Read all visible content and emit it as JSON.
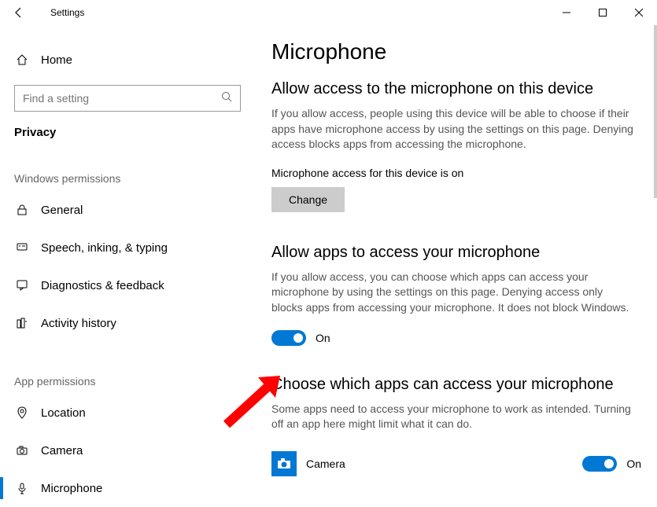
{
  "window": {
    "title": "Settings"
  },
  "sidebar": {
    "home": "Home",
    "search_placeholder": "Find a setting",
    "breadcrumb": "Privacy",
    "section1_header": "Windows permissions",
    "section2_header": "App permissions",
    "items1": [
      {
        "label": "General"
      },
      {
        "label": "Speech, inking, & typing"
      },
      {
        "label": "Diagnostics & feedback"
      },
      {
        "label": "Activity history"
      }
    ],
    "items2": [
      {
        "label": "Location"
      },
      {
        "label": "Camera"
      },
      {
        "label": "Microphone"
      }
    ]
  },
  "content": {
    "page_title": "Microphone",
    "sec1_title": "Allow access to the microphone on this device",
    "sec1_desc": "If you allow access, people using this device will be able to choose if their apps have microphone access by using the settings on this page. Denying access blocks apps from accessing the microphone.",
    "sec1_status": "Microphone access for this device is on",
    "change_btn": "Change",
    "sec2_title": "Allow apps to access your microphone",
    "sec2_desc": "If you allow access, you can choose which apps can access your microphone by using the settings on this page. Denying access only blocks apps from accessing your microphone. It does not block Windows.",
    "toggle_state": "On",
    "sec3_title": "Choose which apps can access your microphone",
    "sec3_desc": "Some apps need to access your microphone to work as intended. Turning off an app here might limit what it can do.",
    "apps": [
      {
        "name": "Camera",
        "state": "On"
      }
    ]
  }
}
